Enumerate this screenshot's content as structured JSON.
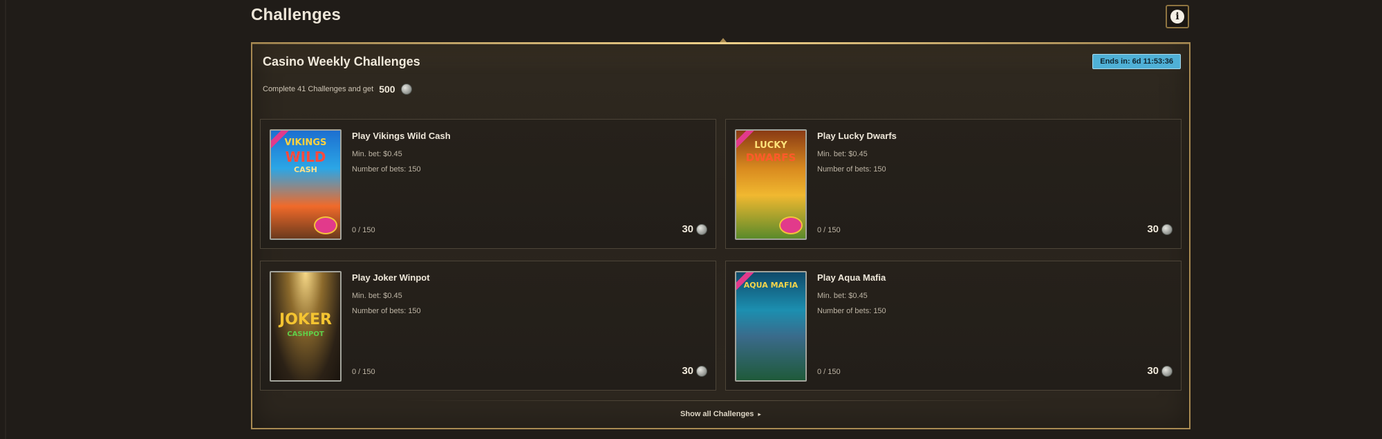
{
  "header": {
    "title": "Challenges",
    "info_icon": "info-icon"
  },
  "panel": {
    "title": "Casino Weekly Challenges",
    "countdown": "Ends in: 6d 11:53:36",
    "reward_text": "Complete 41 Challenges and get",
    "reward_amount": "500",
    "coin_icon": "coin-icon",
    "show_all_label": "Show all Challenges",
    "show_all_icon": "caret-right-icon"
  },
  "challenges": [
    {
      "title": "Play Vikings Wild Cash",
      "min_bet": "Min. bet: $0.45",
      "num_bets": "Number of bets: 150",
      "progress": "0 / 150",
      "points": "30",
      "thumb_text": [
        "VIKINGS",
        "WILD",
        "CASH"
      ]
    },
    {
      "title": "Play Lucky Dwarfs",
      "min_bet": "Min. bet: $0.45",
      "num_bets": "Number of bets: 150",
      "progress": "0 / 150",
      "points": "30",
      "thumb_text": [
        "LUCKY",
        "DWARFS"
      ]
    },
    {
      "title": "Play Joker Winpot",
      "min_bet": "Min. bet: $0.45",
      "num_bets": "Number of bets: 150",
      "progress": "0 / 150",
      "points": "30",
      "thumb_text": [
        "JOKER",
        "CASHPOT"
      ]
    },
    {
      "title": "Play Aqua Mafia",
      "min_bet": "Min. bet: $0.45",
      "num_bets": "Number of bets: 150",
      "progress": "0 / 150",
      "points": "30",
      "thumb_text": [
        "AQUA MAFIA"
      ]
    }
  ]
}
